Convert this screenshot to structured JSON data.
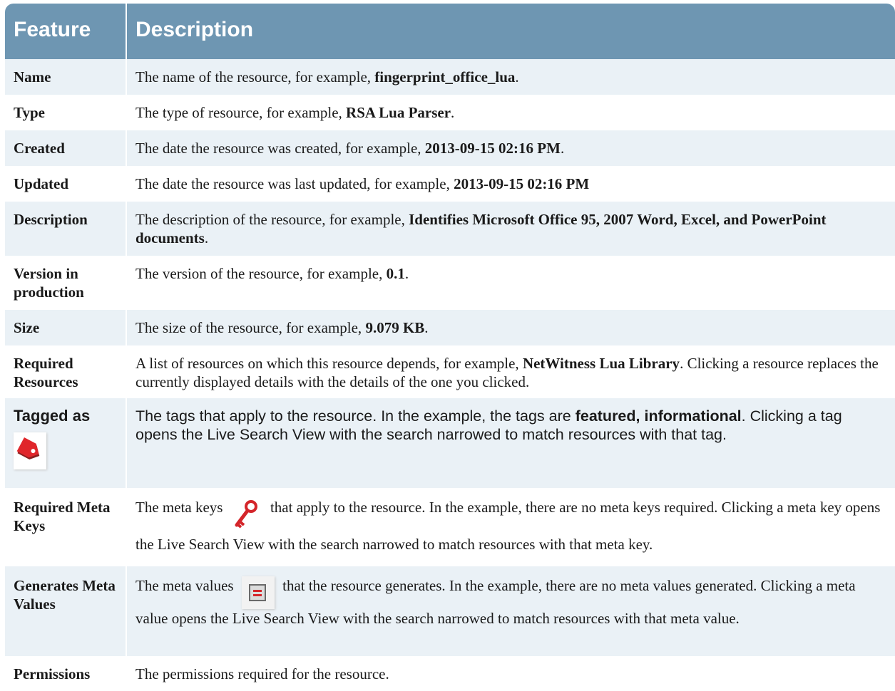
{
  "header": {
    "feature": "Feature",
    "description": "Description"
  },
  "rows": [
    {
      "feature": "Name",
      "desc_pre": "The name of the resource, for example, ",
      "desc_bold": "fingerprint_office_lua",
      "desc_post": "."
    },
    {
      "feature": "Type",
      "desc_pre": "The type of resource, for example, ",
      "desc_bold": "RSA Lua Parser",
      "desc_post": "."
    },
    {
      "feature": "Created",
      "desc_pre": "The date the resource was created, for example, ",
      "desc_bold": "2013-09-15 02:16 PM",
      "desc_post": "."
    },
    {
      "feature": "Updated",
      "desc_pre": "The date the resource was last updated, for example, ",
      "desc_bold": "2013-09-15 02:16 PM",
      "desc_post": ""
    },
    {
      "feature": "Description",
      "desc_pre": "The description of the resource, for example, ",
      "desc_bold": "Identifies Microsoft Office 95, 2007 Word, Excel, and PowerPoint documents",
      "desc_post": "."
    },
    {
      "feature": "Version in production",
      "desc_pre": "The version of the resource, for example, ",
      "desc_bold": "0.1",
      "desc_post": "."
    },
    {
      "feature": "Size",
      "desc_pre": "The size of the resource, for example, ",
      "desc_bold": "9.079 KB",
      "desc_post": "."
    },
    {
      "feature": "Required Resources",
      "desc_pre": "A list of resources on which this resource depends, for example, ",
      "desc_bold": "NetWitness Lua Library",
      "desc_post": ". Clicking a resource replaces the currently displayed details with the details of the one you clicked."
    },
    {
      "feature": "Tagged as",
      "icon": "tag-icon",
      "desc_pre": "The tags that apply to the resource. In the example, the tags are ",
      "desc_bold": "featured, informational",
      "desc_post": ". Clicking a tag opens the Live Search View with the search narrowed to match resources with that tag."
    },
    {
      "feature": "Required Meta Keys",
      "icon": "key-icon",
      "desc_pre": "The meta keys ",
      "desc_post": " that apply to the resource. In the example, there are no meta keys required. Clicking a meta key opens the Live Search View with the search narrowed to match resources with that meta key."
    },
    {
      "feature": "Generates Meta Values",
      "icon": "meta-values-icon",
      "desc_pre": "The meta values ",
      "desc_post": " that the resource generates. In the example, there are no meta values generated. Clicking a meta value opens the Live Search View with the search narrowed to match resources with that meta value."
    },
    {
      "feature": "Permissions",
      "desc_pre": "The permissions required for the resource."
    }
  ]
}
